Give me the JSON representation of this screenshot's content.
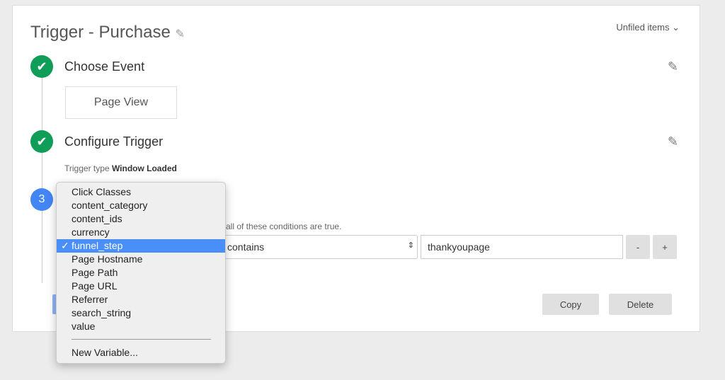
{
  "header": {
    "title": "Trigger - Purchase",
    "folder": "Unfiled items"
  },
  "steps": [
    {
      "status": "done",
      "title": "Choose Event",
      "event": "Page View"
    },
    {
      "status": "done",
      "title": "Configure Trigger",
      "type_label": "Trigger type",
      "type_value": "Window Loaded"
    },
    {
      "number": "3",
      "conditions_text": "all of these conditions are true.",
      "operator": "contains",
      "value": "thankyoupage",
      "remove": "-",
      "add": "+"
    }
  ],
  "actions": {
    "copy": "Copy",
    "delete": "Delete"
  },
  "dropdown": {
    "check": "✓",
    "selected": "funnel_step",
    "items": [
      "Click Classes",
      "content_category",
      "content_ids",
      "currency",
      "funnel_step",
      "Page Hostname",
      "Page Path",
      "Page URL",
      "Referrer",
      "search_string",
      "value"
    ],
    "new_variable": "New Variable..."
  },
  "colors": {
    "done": "#0f9d58",
    "active": "#4285f4",
    "highlight": "#4a8ef7"
  }
}
